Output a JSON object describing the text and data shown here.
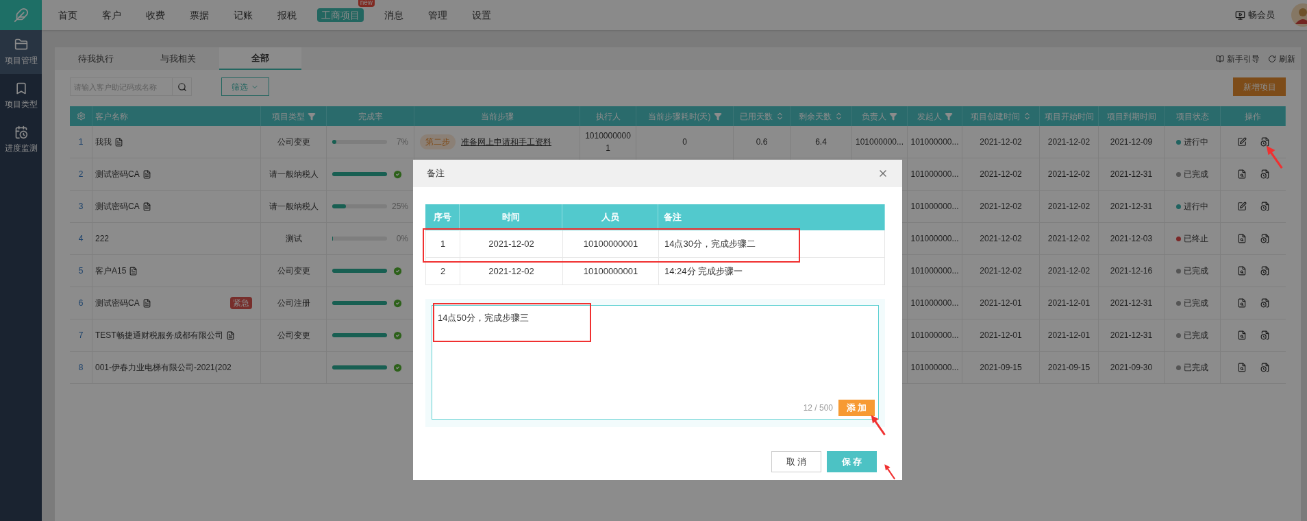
{
  "nav": {
    "items": [
      {
        "label": "首页",
        "selected": false
      },
      {
        "label": "客户",
        "selected": false
      },
      {
        "label": "收费",
        "selected": false
      },
      {
        "label": "票据",
        "selected": false
      },
      {
        "label": "记账",
        "selected": false
      },
      {
        "label": "报税",
        "selected": false
      },
      {
        "label": "工商项目",
        "selected": true,
        "badge": "new"
      },
      {
        "label": "消息",
        "selected": false
      },
      {
        "label": "管理",
        "selected": false
      },
      {
        "label": "设置",
        "selected": false
      }
    ],
    "member": "畅会员"
  },
  "sidebar": {
    "items": [
      {
        "label": "项目管理",
        "selected": true
      },
      {
        "label": "项目类型",
        "selected": false
      },
      {
        "label": "进度监测",
        "selected": false
      }
    ]
  },
  "tabs": [
    {
      "label": "待我执行",
      "selected": false
    },
    {
      "label": "与我相关",
      "selected": false
    },
    {
      "label": "全部",
      "selected": true
    }
  ],
  "toolbar_links": [
    "新手引导",
    "刷新"
  ],
  "search": {
    "placeholder": "请输入客户助记码或名称"
  },
  "filter_button": "筛选",
  "add_button": "新增项目",
  "table": {
    "columns": [
      "",
      "客户名称",
      "项目类型",
      "完成率",
      "当前步骤",
      "执行人",
      "当前步骤耗时(天)",
      "已用天数",
      "剩余天数",
      "负责人",
      "发起人",
      "项目创建时间",
      "项目开始时间",
      "项目到期时间",
      "项目状态",
      "操作"
    ],
    "rows": [
      {
        "index": "1",
        "name": "我我",
        "has_doc": true,
        "type": "公司变更",
        "progress": {
          "level": 0.07,
          "complete": false,
          "percent": "7%"
        },
        "step": {
          "badge": "第二步",
          "title": "准备网上申请和手工资料"
        },
        "executor": "10100000001",
        "step_days": "0",
        "used_days": "0.6",
        "remaining_days": "6.4",
        "owner": "101000000...",
        "initiator": "101000000...",
        "created": "2021-12-02",
        "start": "2021-12-02",
        "due": "2021-12-09",
        "status": {
          "label": "进行中",
          "color": "#206360"
        },
        "editable": true
      },
      {
        "index": "2",
        "name": "测试密码CA",
        "has_doc": true,
        "type": "请一般纳税人",
        "progress": {
          "level": 1,
          "complete": true
        },
        "initiator": "101000000...",
        "created": "2021-12-02",
        "start": "2021-12-02",
        "due": "2021-12-31",
        "status": {
          "label": "已完成",
          "color": "#555555"
        },
        "editable": false
      },
      {
        "index": "3",
        "name": "测试密码CA",
        "has_doc": true,
        "type": "请一般纳税人",
        "progress": {
          "level": 0.25,
          "complete": false,
          "percent": "25%"
        },
        "initiator": "101000000...",
        "created": "2021-12-02",
        "start": "2021-12-02",
        "due": "2021-12-31",
        "status": {
          "label": "进行中",
          "color": "#206360"
        },
        "editable": true
      },
      {
        "index": "4",
        "name": "222",
        "has_doc": false,
        "type": "测试",
        "progress": {
          "level": 0,
          "complete": false,
          "percent": "0%"
        },
        "initiator": "101000000...",
        "created": "2021-12-02",
        "start": "2021-12-02",
        "due": "2021-12-03",
        "status": {
          "label": "已终止",
          "color": "#7b2828"
        },
        "editable": false
      },
      {
        "index": "5",
        "name": "客户A15",
        "has_doc": true,
        "type": "公司变更",
        "progress": {
          "level": 1,
          "complete": true
        },
        "initiator": "101000000...",
        "created": "2021-12-02",
        "start": "2021-12-02",
        "due": "2021-12-16",
        "status": {
          "label": "已完成",
          "color": "#555555"
        },
        "editable": false
      },
      {
        "index": "6",
        "name": "测试密码CA",
        "has_doc": true,
        "tag": "紧急",
        "type": "公司注册",
        "progress": {
          "level": 1,
          "complete": true
        },
        "initiator": "101000000...",
        "created": "2021-12-01",
        "start": "2021-12-01",
        "due": "2021-12-31",
        "status": {
          "label": "已完成",
          "color": "#555555"
        },
        "editable": false
      },
      {
        "index": "7",
        "name": "TEST畅捷通财税服务成都有限公司",
        "has_doc": true,
        "type": "公司变更",
        "progress": {
          "level": 1,
          "complete": true
        },
        "initiator": "101000000...",
        "created": "2021-12-01",
        "start": "2021-12-01",
        "due": "2021-12-31",
        "status": {
          "label": "已完成",
          "color": "#555555"
        },
        "editable": false
      },
      {
        "index": "8",
        "name": "001-伊春力业电梯有限公司-2021(202",
        "has_doc": false,
        "progress": {
          "level": 1,
          "complete": true
        },
        "initiator": "101000000...",
        "created": "2021-09-15",
        "start": "2021-09-15",
        "due": "2021-09-30",
        "status": {
          "label": "已完成",
          "color": "#555555"
        },
        "editable": false
      }
    ]
  },
  "dialog": {
    "title": "备注",
    "columns": [
      "序号",
      "时间",
      "人员",
      "备注"
    ],
    "rows": [
      [
        "1",
        "2021-12-02",
        "10100000001",
        "14点30分，完成步骤二"
      ],
      [
        "2",
        "2021-12-02",
        "10100000001",
        "14:24分 完成步骤一"
      ]
    ],
    "note_value": "14点50分，完成步骤三",
    "counter": "12 / 500",
    "add_button": "添 加",
    "cancel_button": "取 消",
    "save_button": "保 存"
  }
}
